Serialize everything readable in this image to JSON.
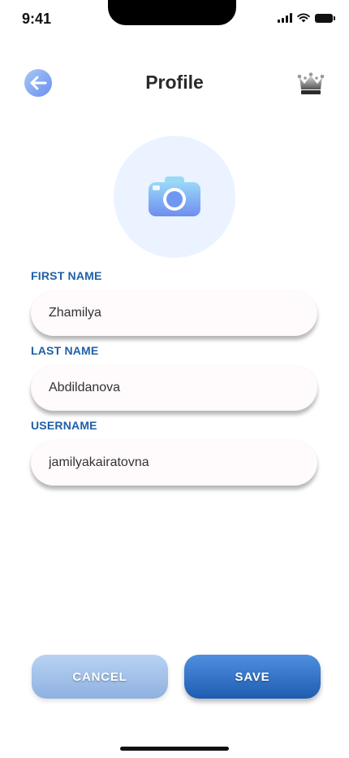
{
  "status_bar": {
    "time": "9:41"
  },
  "header": {
    "title": "Profile",
    "back_icon": "arrow-left-icon",
    "premium_icon": "crown-icon"
  },
  "avatar": {
    "icon": "camera-icon"
  },
  "form": {
    "first_name": {
      "label": "FIRST NAME",
      "value": "Zhamilya"
    },
    "last_name": {
      "label": "LAST NAME",
      "value": "Abdildanova"
    },
    "username": {
      "label": "USERNAME",
      "value": "jamilyakairatovna"
    }
  },
  "actions": {
    "cancel_label": "CANCEL",
    "save_label": "SAVE"
  },
  "colors": {
    "accent": "#1f5fa8",
    "save_button": "#2f6fc4",
    "cancel_button": "#a9c4ea",
    "avatar_bg": "#eaf3ff"
  }
}
